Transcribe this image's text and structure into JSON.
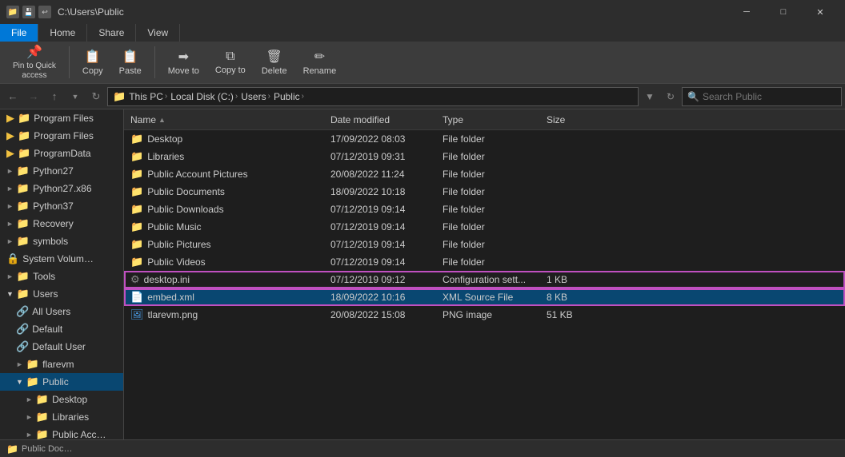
{
  "titlebar": {
    "title": "C:\\Users\\Public",
    "icons": [
      "📁",
      "💻",
      "🗂"
    ],
    "btn_minimize": "─",
    "btn_maximize": "□",
    "btn_close": "✕"
  },
  "ribbon": {
    "tabs": [
      {
        "label": "File",
        "active": true
      },
      {
        "label": "Home",
        "active": false
      },
      {
        "label": "Share",
        "active": false
      },
      {
        "label": "View",
        "active": false
      }
    ],
    "buttons": [
      {
        "label": "Pin to Quick\naccess",
        "icon": "📌"
      },
      {
        "label": "Copy",
        "icon": "📋"
      },
      {
        "label": "Paste",
        "icon": "📋"
      },
      {
        "label": "Move to",
        "icon": "➡"
      },
      {
        "label": "Copy to",
        "icon": "⧉"
      },
      {
        "label": "Delete",
        "icon": "🗑"
      },
      {
        "label": "Rename",
        "icon": "✏"
      }
    ]
  },
  "navbar": {
    "back_disabled": false,
    "forward_disabled": true,
    "up_disabled": false,
    "address_parts": [
      "This PC",
      "Local Disk (C:)",
      "Users",
      "Public"
    ],
    "search_placeholder": "Search Public",
    "search_value": ""
  },
  "sidebar": {
    "items": [
      {
        "label": "Program Files",
        "indent": 0,
        "icon": "folder",
        "expanded": false
      },
      {
        "label": "Program Files",
        "indent": 0,
        "icon": "folder",
        "expanded": false
      },
      {
        "label": "ProgramData",
        "indent": 0,
        "icon": "folder",
        "expanded": false
      },
      {
        "label": "Python27",
        "indent": 0,
        "icon": "folder",
        "expanded": false
      },
      {
        "label": "Python27.x86",
        "indent": 0,
        "icon": "folder",
        "expanded": false
      },
      {
        "label": "Python37",
        "indent": 0,
        "icon": "folder",
        "expanded": false
      },
      {
        "label": "Recovery",
        "indent": 0,
        "icon": "folder",
        "expanded": false
      },
      {
        "label": "symbols",
        "indent": 0,
        "icon": "folder",
        "expanded": false
      },
      {
        "label": "System Volum…",
        "indent": 0,
        "icon": "folder",
        "expanded": false
      },
      {
        "label": "Tools",
        "indent": 0,
        "icon": "folder",
        "expanded": false
      },
      {
        "label": "Users",
        "indent": 0,
        "icon": "folder",
        "expanded": true
      },
      {
        "label": "All Users",
        "indent": 1,
        "icon": "special",
        "expanded": false
      },
      {
        "label": "Default",
        "indent": 1,
        "icon": "special",
        "expanded": false
      },
      {
        "label": "Default User",
        "indent": 1,
        "icon": "special",
        "expanded": false
      },
      {
        "label": "flarevm",
        "indent": 1,
        "icon": "folder",
        "expanded": false
      },
      {
        "label": "Public",
        "indent": 1,
        "icon": "folder",
        "expanded": true,
        "selected": true
      },
      {
        "label": "Desktop",
        "indent": 2,
        "icon": "folder",
        "expanded": false
      },
      {
        "label": "Libraries",
        "indent": 2,
        "icon": "folder",
        "expanded": false
      },
      {
        "label": "Public Acc…",
        "indent": 2,
        "icon": "folder",
        "expanded": false
      },
      {
        "label": "Public Doc…",
        "indent": 2,
        "icon": "folder",
        "expanded": false
      }
    ]
  },
  "columns": {
    "name": "Name",
    "date": "Date modified",
    "type": "Type",
    "size": "Size"
  },
  "files": [
    {
      "name": "Desktop",
      "date": "17/09/2022 08:03",
      "type": "File folder",
      "size": "",
      "icon": "folder",
      "selected": false,
      "highlighted": false
    },
    {
      "name": "Libraries",
      "date": "07/12/2019 09:31",
      "type": "File folder",
      "size": "",
      "icon": "folder",
      "selected": false,
      "highlighted": false
    },
    {
      "name": "Public Account Pictures",
      "date": "20/08/2022 11:24",
      "type": "File folder",
      "size": "",
      "icon": "folder",
      "selected": false,
      "highlighted": false
    },
    {
      "name": "Public Documents",
      "date": "18/09/2022 10:18",
      "type": "File folder",
      "size": "",
      "icon": "folder",
      "selected": false,
      "highlighted": false
    },
    {
      "name": "Public Downloads",
      "date": "07/12/2019 09:14",
      "type": "File folder",
      "size": "",
      "icon": "folder",
      "selected": false,
      "highlighted": false
    },
    {
      "name": "Public Music",
      "date": "07/12/2019 09:14",
      "type": "File folder",
      "size": "",
      "icon": "folder",
      "selected": false,
      "highlighted": false
    },
    {
      "name": "Public Pictures",
      "date": "07/12/2019 09:14",
      "type": "File folder",
      "size": "",
      "icon": "folder",
      "selected": false,
      "highlighted": false
    },
    {
      "name": "Public Videos",
      "date": "07/12/2019 09:14",
      "type": "File folder",
      "size": "",
      "icon": "folder",
      "selected": false,
      "highlighted": false
    },
    {
      "name": "desktop.ini",
      "date": "07/12/2019 09:12",
      "type": "Configuration sett...",
      "size": "1 KB",
      "icon": "config",
      "selected": false,
      "highlighted": true
    },
    {
      "name": "embed.xml",
      "date": "18/09/2022 10:16",
      "type": "XML Source File",
      "size": "8 KB",
      "icon": "xml",
      "selected": true,
      "highlighted": true
    },
    {
      "name": "tlarevm.png",
      "date": "20/08/2022 15:08",
      "type": "PNG image",
      "size": "51 KB",
      "icon": "image",
      "selected": false,
      "highlighted": false
    }
  ],
  "statusbar": {
    "text": "Public Doc…",
    "item_count": ""
  }
}
